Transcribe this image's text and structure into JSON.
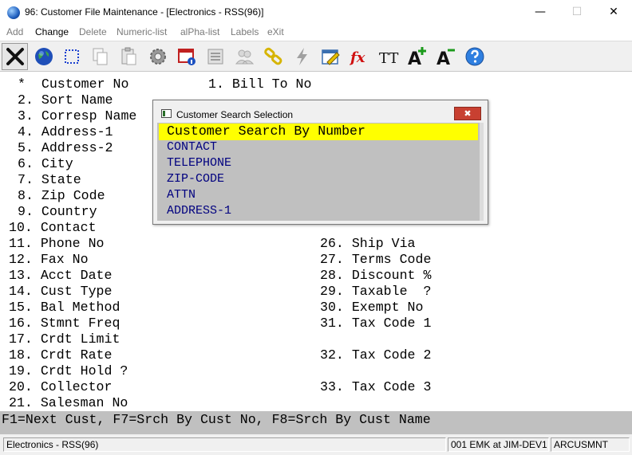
{
  "window": {
    "title": "96: Customer File Maintenance - [Electronics - RSS(96)]",
    "min_glyph": "—",
    "max_glyph": "☐",
    "close_glyph": "✕"
  },
  "menu": {
    "items": [
      "Add",
      "Change",
      "Delete",
      "Numeric-list",
      "alPha-list",
      "Labels",
      "eXit"
    ],
    "active": "Change"
  },
  "toolbar": {
    "icons": [
      "exit-icon",
      "globe-icon",
      "select-icon",
      "copy-icon",
      "paste-icon",
      "settings-icon",
      "form-info-icon",
      "list-icon",
      "users-icon",
      "link-icon",
      "lightning-icon",
      "calendar-edit-icon",
      "function-icon",
      "font-size-icon",
      "font-increase-icon",
      "font-decrease-icon",
      "help-icon"
    ],
    "function_label": "fx",
    "font_size_label": "TT",
    "font_increase_label": "A",
    "font_decrease_label": "A"
  },
  "fields_left": [
    "*  Customer No",
    "2. Sort Name",
    "3. Corresp Name",
    "4. Address-1",
    "5. Address-2",
    "6. City",
    "7. State",
    "8. Zip Code",
    "9. Country",
    "10. Contact",
    "11. Phone No",
    "12. Fax No",
    "13. Acct Date",
    "14. Cust Type",
    "15. Bal Method",
    "16. Stmnt Freq",
    "17. Crdt Limit",
    "18. Crdt Rate",
    "19. Crdt Hold ?",
    "20. Collector",
    "21. Salesman No"
  ],
  "field_bill_to": "1. Bill To No",
  "fields_right": [
    "26. Ship Via",
    "27. Terms Code",
    "28. Discount %",
    "29. Taxable  ?",
    "30. Exempt No",
    "31. Tax Code 1",
    "32. Tax Code 2",
    "33. Tax Code 3"
  ],
  "popup": {
    "title": "Customer Search Selection",
    "close_glyph": "✖",
    "options": [
      "Customer Search By Number",
      "CONTACT",
      "TELEPHONE",
      "ZIP-CODE",
      "ATTN",
      "ADDRESS-1"
    ],
    "selected": "Customer Search By Number"
  },
  "fkeys": "F1=Next Cust, F7=Srch By Cust No, F8=Srch By Cust Name",
  "status": {
    "company": "Electronics - RSS(96)",
    "session": "001 EMK at JIM-DEV1",
    "program": "ARCUSMNT"
  },
  "colors": {
    "selected_bg": "#ffff00",
    "option_text": "#00007f",
    "popup_list_bg": "#c0c0c0",
    "fkey_bg": "#c0c0c0",
    "close_red": "#c84031"
  }
}
